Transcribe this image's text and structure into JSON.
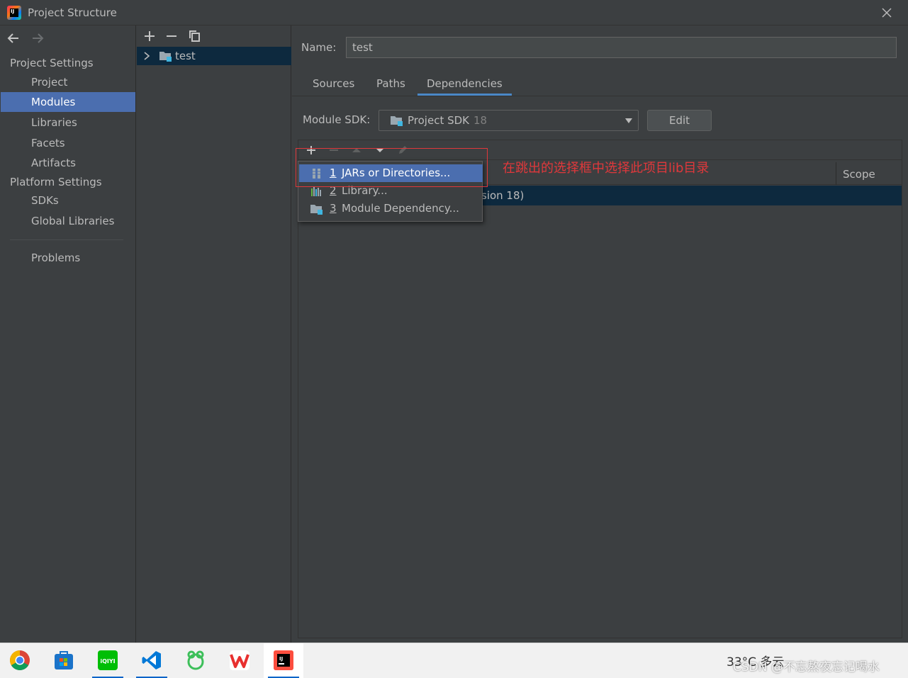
{
  "window": {
    "title": "Project Structure"
  },
  "sidebar": {
    "sections": [
      {
        "label": "Project Settings",
        "items": [
          "Project",
          "Modules",
          "Libraries",
          "Facets",
          "Artifacts"
        ]
      },
      {
        "label": "Platform Settings",
        "items": [
          "SDKs",
          "Global Libraries"
        ]
      }
    ],
    "extra_item": "Problems",
    "selected": "Modules"
  },
  "modules_tree": {
    "items": [
      {
        "label": "test"
      }
    ]
  },
  "module": {
    "name_label": "Name:",
    "name_value": "test",
    "tabs": [
      "Sources",
      "Paths",
      "Dependencies"
    ],
    "active_tab": "Dependencies",
    "sdk_label": "Module SDK:",
    "sdk_value": "Project SDK",
    "sdk_version": "18",
    "edit_label": "Edit"
  },
  "dependencies": {
    "scope_header": "Scope",
    "row_text": "sion 18)"
  },
  "add_popup": {
    "items": [
      {
        "num": "1",
        "label": "JARs or Directories...",
        "icon": "jar-directory-icon"
      },
      {
        "num": "2",
        "label": "Library...",
        "icon": "library-icon"
      },
      {
        "num": "3",
        "label": "Module Dependency...",
        "icon": "module-icon"
      }
    ],
    "selected_index": 0
  },
  "annotation": {
    "text": "在跳出的选择框中选择此项目lib目录",
    "color": "#e0383b"
  },
  "taskbar": {
    "apps": [
      "chrome-icon",
      "store-icon",
      "iqiyi-icon",
      "vscode-icon",
      "game-icon",
      "wps-icon",
      "intellij-icon"
    ],
    "iqiyi_label": "iQIYI",
    "intellij_label": "IJ",
    "tray_text": "33°C 多云",
    "watermark": "CSDN @不忘熬夜忘记喝水"
  },
  "colors": {
    "selection": "#4b6eaf",
    "panel_bg": "#3c3f41",
    "row_selected": "#0d293e",
    "annotation": "#e0383b"
  }
}
